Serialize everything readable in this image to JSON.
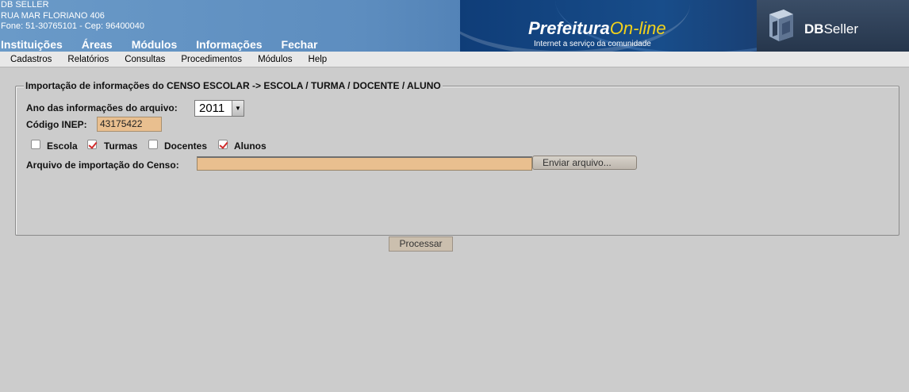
{
  "company": {
    "name": "DB SELLER",
    "address": "RUA MAR FLORIANO 406",
    "contact": "Fone: 51-30765101  -  Cep: 96400040"
  },
  "topnav": [
    "Instituições",
    "Áreas",
    "Módulos",
    "Informações",
    "Fechar"
  ],
  "banner": {
    "brand_main": "Prefeitura",
    "brand_online": "On-line",
    "tagline": "Internet a serviço da comunidade",
    "db_logo_text_bold": "DB",
    "db_logo_text": "Seller"
  },
  "menubar": [
    "Cadastros",
    "Relatórios",
    "Consultas",
    "Procedimentos",
    "Módulos",
    "Help"
  ],
  "form": {
    "legend": "Importação de informações do CENSO ESCOLAR -> ESCOLA / TURMA / DOCENTE / ALUNO",
    "year_label": "Ano das informações do arquivo:",
    "year_value": "2011",
    "inep_label": "Código INEP:",
    "inep_value": "43175422",
    "checkboxes": [
      {
        "label": "Escola",
        "checked": false
      },
      {
        "label": "Turmas",
        "checked": true
      },
      {
        "label": "Docentes",
        "checked": false
      },
      {
        "label": "Alunos",
        "checked": true
      }
    ],
    "file_label": "Arquivo de importação do Censo:",
    "file_value": "",
    "upload_button": "Enviar arquivo...",
    "process_button": "Processar"
  },
  "colors": {
    "input_fill": "#e9bf8f",
    "page_bg": "#cccccc",
    "check_mark": "#d12b2b"
  }
}
